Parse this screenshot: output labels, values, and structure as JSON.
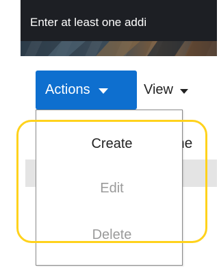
{
  "banner": {
    "text": "Enter at least one addi"
  },
  "toolbar": {
    "actions_label": "Actions",
    "view_label": "View"
  },
  "background": {
    "column_header_fragment": "ne"
  },
  "actions_menu": {
    "items": [
      {
        "label": "Create",
        "enabled": true
      },
      {
        "label": "Edit",
        "enabled": false
      },
      {
        "label": "Delete",
        "enabled": false
      }
    ]
  },
  "colors": {
    "actions_button": "#0e6fcf",
    "highlight": "#ffd21c",
    "banner_text_bg": "#1d1f24",
    "disabled_text": "#9a9a9a"
  },
  "icons": {
    "actions_caret": "chevron-down-icon",
    "view_caret": "chevron-down-icon"
  }
}
